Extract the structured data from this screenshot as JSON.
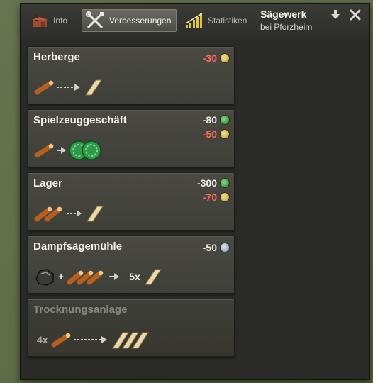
{
  "window": {
    "title": "Sägewerk",
    "subtitle": "bei Pforzheim"
  },
  "tabs": [
    {
      "label": "Info",
      "icon": "building-icon",
      "active": false
    },
    {
      "label": "Verbesserungen",
      "icon": "tools-icon",
      "active": true
    },
    {
      "label": "Statistiken",
      "icon": "bar-chart-icon",
      "active": false
    }
  ],
  "colors": {
    "cost_red": "#ff6a5a",
    "cost_white": "#f2f2ea",
    "active_tab": "#5c5c55"
  },
  "upgrades": [
    {
      "name": "Herberge",
      "costs": [
        {
          "value": "-30",
          "currency": "gold-coin",
          "color": "red"
        }
      ],
      "recipe": {
        "inputs": [
          "log"
        ],
        "outputs": [
          "plank"
        ]
      }
    },
    {
      "name": "Spielzeuggeschäft",
      "costs": [
        {
          "value": "-80",
          "currency": "green-coin",
          "color": "white"
        },
        {
          "value": "-50",
          "currency": "gold-coin",
          "color": "red"
        }
      ],
      "recipe": {
        "inputs": [
          "log"
        ],
        "outputs": [
          "toy-ball",
          "toy-ball"
        ]
      }
    },
    {
      "name": "Lager",
      "costs": [
        {
          "value": "-300",
          "currency": "green-coin",
          "color": "white"
        },
        {
          "value": "-70",
          "currency": "gold-coin",
          "color": "red"
        }
      ],
      "recipe": {
        "inputs": [
          "log",
          "log"
        ],
        "outputs": [
          "plank"
        ]
      }
    },
    {
      "name": "Dampfsägemühle",
      "costs": [
        {
          "value": "-50",
          "currency": "silver-coin",
          "color": "white"
        }
      ],
      "recipe": {
        "inputs": [
          "coal",
          "log",
          "log",
          "log"
        ],
        "output_qty": "5x",
        "outputs": [
          "plank"
        ]
      }
    },
    {
      "name": "Trocknungsanlage",
      "disabled": true,
      "costs": [],
      "recipe": {
        "input_qty": "4x",
        "inputs": [
          "log"
        ],
        "outputs": [
          "plank",
          "plank",
          "plank"
        ]
      }
    }
  ]
}
